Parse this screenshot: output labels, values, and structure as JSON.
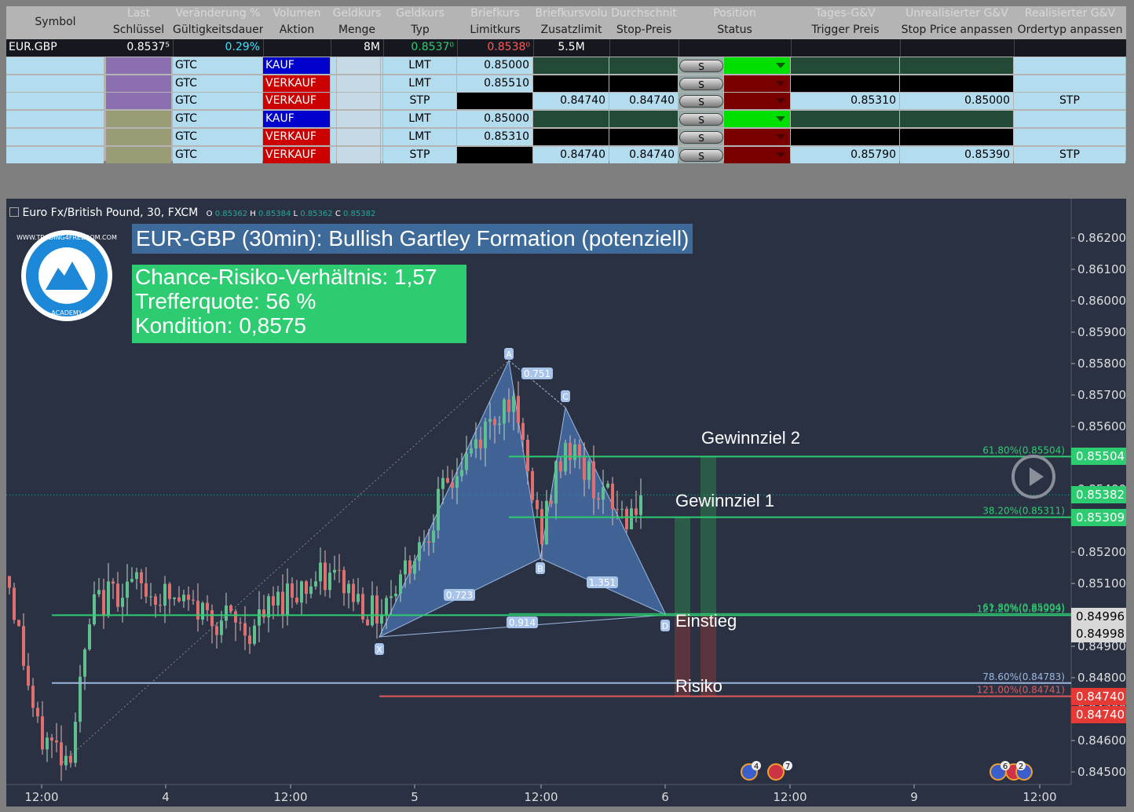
{
  "orders": {
    "headers_top": [
      "Last",
      "Veränderung %",
      "Volumen",
      "Geldkurs",
      "Geldkurs",
      "Briefkurs",
      "Briefkursvolu",
      "Durchschnit",
      "Position",
      "Tages-G&V",
      "Unrealisierter G&V",
      "Realisierter G&V"
    ],
    "headers_bottom": [
      "Schlüssel",
      "Gültigkeitsdauer",
      "Aktion",
      "Menge",
      "Typ",
      "Limitkurs",
      "Zusatzlimit",
      "Stop-Preis",
      "Status",
      "Trigger Preis",
      "Stop Price anpassen",
      "Ordertyp anpassen"
    ],
    "symbol_header": "Symbol",
    "quote": {
      "symbol": "EUR.GBP",
      "last": "0.8537⁵",
      "change": "0.29%",
      "bid_size": "8M",
      "bid": "0.8537⁰",
      "ask": "0.8538⁰",
      "ask_size": "5.5M"
    },
    "rows": [
      {
        "tif": "GTC",
        "action": "KAUF",
        "type": "LMT",
        "limit": "0.85000",
        "aux": "",
        "stop": "",
        "status_btn": "S",
        "trigger": "",
        "stop_adj": "",
        "type_adj": ""
      },
      {
        "tif": "GTC",
        "action": "VERKAUF",
        "type": "LMT",
        "limit": "0.85510",
        "aux": "",
        "stop": "",
        "status_btn": "S",
        "trigger": "",
        "stop_adj": "",
        "type_adj": ""
      },
      {
        "tif": "GTC",
        "action": "VERKAUF",
        "type": "STP",
        "limit": "",
        "aux": "0.84740",
        "stop": "0.84740",
        "status_btn": "S",
        "trigger": "0.85310",
        "stop_adj": "0.85000",
        "type_adj": "STP"
      },
      {
        "tif": "GTC",
        "action": "KAUF",
        "type": "LMT",
        "limit": "0.85000",
        "aux": "",
        "stop": "",
        "status_btn": "S",
        "trigger": "",
        "stop_adj": "",
        "type_adj": ""
      },
      {
        "tif": "GTC",
        "action": "VERKAUF",
        "type": "LMT",
        "limit": "0.85310",
        "aux": "",
        "stop": "",
        "status_btn": "S",
        "trigger": "",
        "stop_adj": "",
        "type_adj": ""
      },
      {
        "tif": "GTC",
        "action": "VERKAUF",
        "type": "STP",
        "limit": "",
        "aux": "0.84740",
        "stop": "0.84740",
        "status_btn": "S",
        "trigger": "0.85790",
        "stop_adj": "0.85390",
        "type_adj": "STP"
      }
    ],
    "colors": {
      "kauf": "#0000cc",
      "verkauf": "#cc0000",
      "cell": "#b3dcef",
      "green_status": "#00e000",
      "red_status": "#7a0000",
      "dark_green": "#224a36"
    }
  },
  "chart": {
    "legend": {
      "title": "Euro Fx/British Pound, 30, FXCM",
      "o_label": "O",
      "o": "0.85362",
      "h_label": "H",
      "h": "0.85384",
      "l_label": "L",
      "l": "0.85362",
      "c_label": "C",
      "c": "0.85382"
    },
    "headline": "EUR-GBP (30min): Bullish Gartley Formation (potenziell)",
    "info_lines": [
      "Chance-Risiko-Verhältnis: 1,57",
      "Trefferquote: 56 %",
      "Kondition: 0,8575"
    ],
    "logo": {
      "text": "WWW.TRADING4FREEDOM.COM",
      "sub": "ACADEMY"
    },
    "labels": {
      "target2": "Gewinnziel 2",
      "target1": "Gewinnziel 1",
      "entry": "Einstieg",
      "risk": "Risiko"
    },
    "fib_labels": [
      "61.80%(0.85504)",
      "38.20%(0.85311)",
      "61.80%(0.85004)",
      "127.20%(0.84999)",
      "78.60%(0.84783)",
      "121.00%(0.84741)"
    ],
    "pattern_points": [
      "X",
      "A",
      "B",
      "C",
      "D"
    ],
    "ratios": [
      "0.751",
      "0.723",
      "1.351",
      "0.914"
    ],
    "price_badges": [
      {
        "price": 0.85504,
        "text": "0.85504",
        "bg": "#2ecc71"
      },
      {
        "price": 0.85382,
        "text": "0.85382",
        "bg": "#2ecc71"
      },
      {
        "price": 0.85309,
        "text": "0.85309",
        "bg": "#2ecc71"
      },
      {
        "price": 0.84996,
        "text": "0.84996",
        "bg": "#d8d8d8"
      },
      {
        "price": 0.84998,
        "text": "0.84998",
        "bg": "#d8d8d8"
      },
      {
        "price": 0.8474,
        "text": "0.84740",
        "bg": "#e53935"
      },
      {
        "price": 0.8474,
        "text": "0.84740",
        "bg": "#e53935"
      }
    ],
    "events": [
      "4",
      "7",
      "6",
      "2"
    ]
  },
  "chart_data": {
    "type": "candlestick",
    "title": "EUR-GBP (30min): Bullish Gartley Formation (potenziell)",
    "ylim": [
      0.8445,
      0.8627
    ],
    "y_ticks": [
      "0.84500",
      "0.84600",
      "0.84700",
      "0.84800",
      "0.84900",
      "0.85000",
      "0.85100",
      "0.85200",
      "0.85300",
      "0.85400",
      "0.85500",
      "0.85600",
      "0.85700",
      "0.85800",
      "0.85900",
      "0.86000",
      "0.86100",
      "0.86200"
    ],
    "x_ticks": [
      "12:00",
      "4",
      "12:00",
      "5",
      "12:00",
      "6",
      "12:00",
      "9",
      "12:00"
    ],
    "pattern": {
      "X": 0.8493,
      "A": 0.8581,
      "B": 0.8518,
      "C": 0.8566,
      "D": 0.85
    },
    "levels": [
      {
        "name": "Gewinnziel 2",
        "value": 0.85504
      },
      {
        "name": "Gewinnziel 1",
        "value": 0.85311
      },
      {
        "name": "Einstieg",
        "value": 0.84999
      },
      {
        "name": "78.60%",
        "value": 0.84783
      },
      {
        "name": "Risiko",
        "value": 0.84741
      }
    ],
    "last_price": 0.85382
  }
}
